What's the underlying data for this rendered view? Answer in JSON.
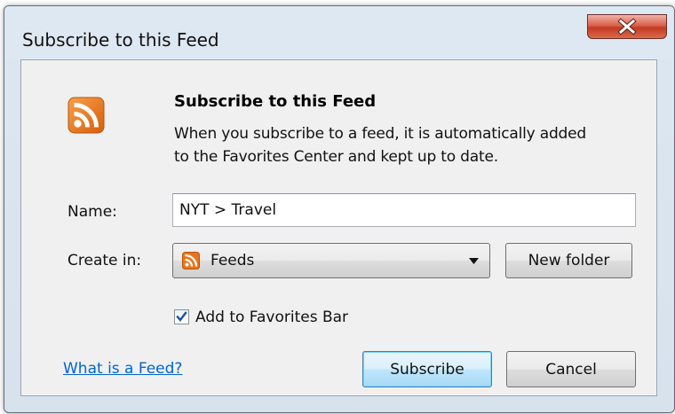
{
  "window": {
    "title": "Subscribe to this Feed"
  },
  "dialog": {
    "heading": "Subscribe to this Feed",
    "description_lines": [
      "When you subscribe to a feed, it is automatically added",
      "to the Favorites Center and kept up to date."
    ],
    "name_label": "Name:",
    "name_value": "NYT > Travel",
    "create_in_label": "Create in:",
    "create_in_value": "Feeds",
    "new_folder_label": "New folder",
    "checkbox_label": "Add to Favorites Bar",
    "checkbox_checked": true,
    "help_link": "What is a Feed?",
    "subscribe_label": "Subscribe",
    "cancel_label": "Cancel"
  },
  "icons": {
    "header_icon": "rss-icon",
    "folder_icon": "rss-icon",
    "close_icon": "close-icon",
    "dropdown_icon": "chevron-down-icon",
    "check_icon": "checkmark-icon"
  },
  "colors": {
    "rss_orange": "#e8751a",
    "link_blue": "#0066cc",
    "close_red": "#c13b22",
    "default_button_border": "#3c7fb1"
  }
}
